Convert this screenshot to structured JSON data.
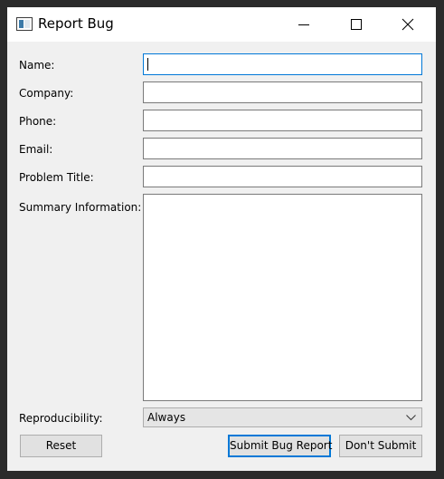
{
  "window": {
    "title": "Report Bug",
    "icons": {
      "app": "app-window-icon",
      "minimize": "minimize-icon",
      "maximize": "maximize-icon",
      "close": "close-icon"
    }
  },
  "form": {
    "name_label": "Name:",
    "name_value": "",
    "company_label": "Company:",
    "company_value": "",
    "phone_label": "Phone:",
    "phone_value": "",
    "email_label": "Email:",
    "email_value": "",
    "problem_title_label": "Problem Title:",
    "problem_title_value": "",
    "summary_label": "Summary Information:",
    "summary_value": "",
    "reproducibility_label": "Reproducibility:",
    "reproducibility_value": "Always"
  },
  "buttons": {
    "reset": "Reset",
    "submit": "Submit Bug Report",
    "dont_submit": "Don't Submit"
  },
  "colors": {
    "focus_accent": "#0078d7",
    "window_bg": "#f0f0f0",
    "titlebar_bg": "#ffffff"
  }
}
